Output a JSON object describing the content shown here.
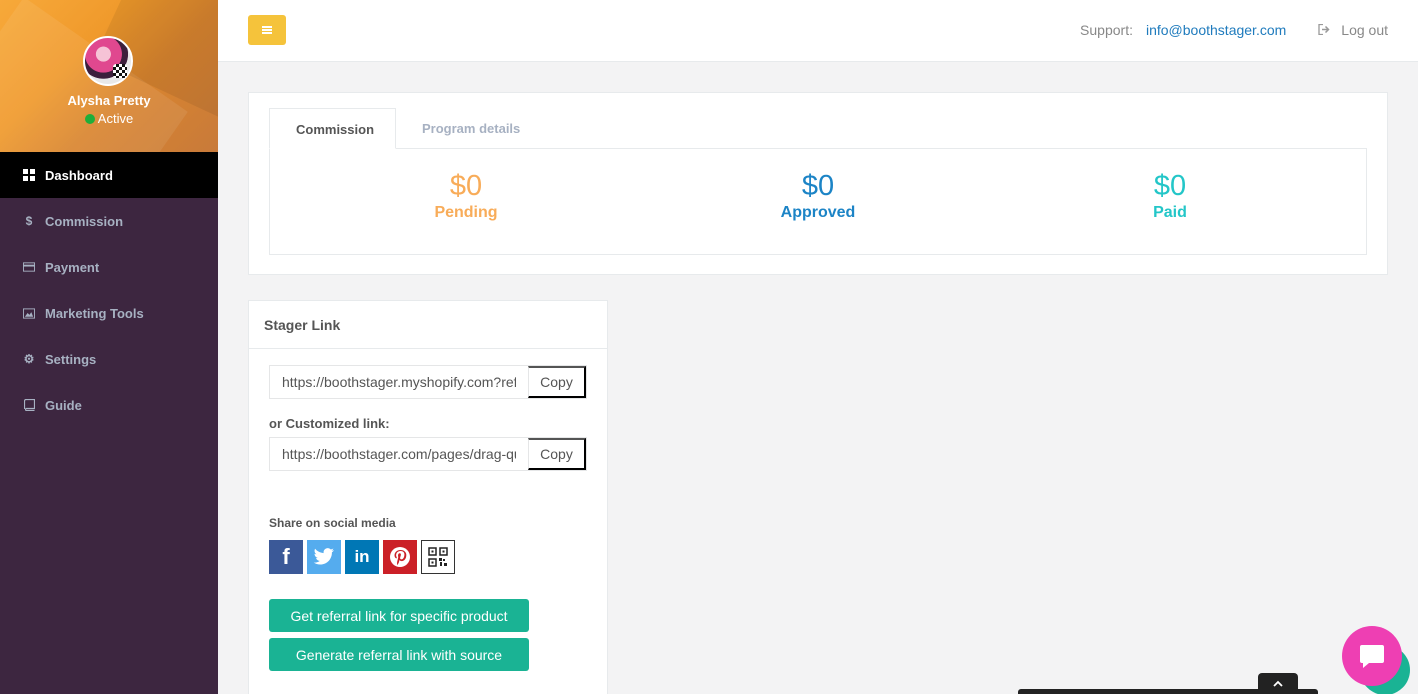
{
  "profile": {
    "name": "Alysha Pretty",
    "status": "Active"
  },
  "sidebar": {
    "items": [
      {
        "label": "Dashboard",
        "icon": "th-large-icon",
        "active": true
      },
      {
        "label": "Commission",
        "icon": "dollar-icon"
      },
      {
        "label": "Payment",
        "icon": "credit-card-icon"
      },
      {
        "label": "Marketing Tools",
        "icon": "image-icon"
      },
      {
        "label": "Settings",
        "icon": "gear-icon"
      },
      {
        "label": "Guide",
        "icon": "book-icon"
      }
    ]
  },
  "topbar": {
    "support_label": "Support:",
    "support_email": "info@boothstager.com",
    "logout_label": "Log out"
  },
  "commission": {
    "tabs": [
      "Commission",
      "Program details"
    ],
    "stats": [
      {
        "value": "$0",
        "label": "Pending",
        "color": "#f8ac59"
      },
      {
        "value": "$0",
        "label": "Approved",
        "color": "#1c84c6"
      },
      {
        "value": "$0",
        "label": "Paid",
        "color": "#23c6c8"
      }
    ]
  },
  "stager": {
    "title": "Stager Link",
    "link": "https://boothstager.myshopify.com?ref=alysha",
    "copy_label": "Copy",
    "custom_label": "or Customized link:",
    "custom_link": "https://boothstager.com/pages/drag-queen",
    "share_label": "Share on social media",
    "btn_product": "Get referral link for specific product",
    "btn_source": "Generate referral link with source"
  },
  "colors": {
    "accent_green": "#1ab394",
    "menu_yellow": "#f5c33b",
    "sidebar_bg": "#3d2640",
    "chat_pink": "#ee3fb3"
  }
}
